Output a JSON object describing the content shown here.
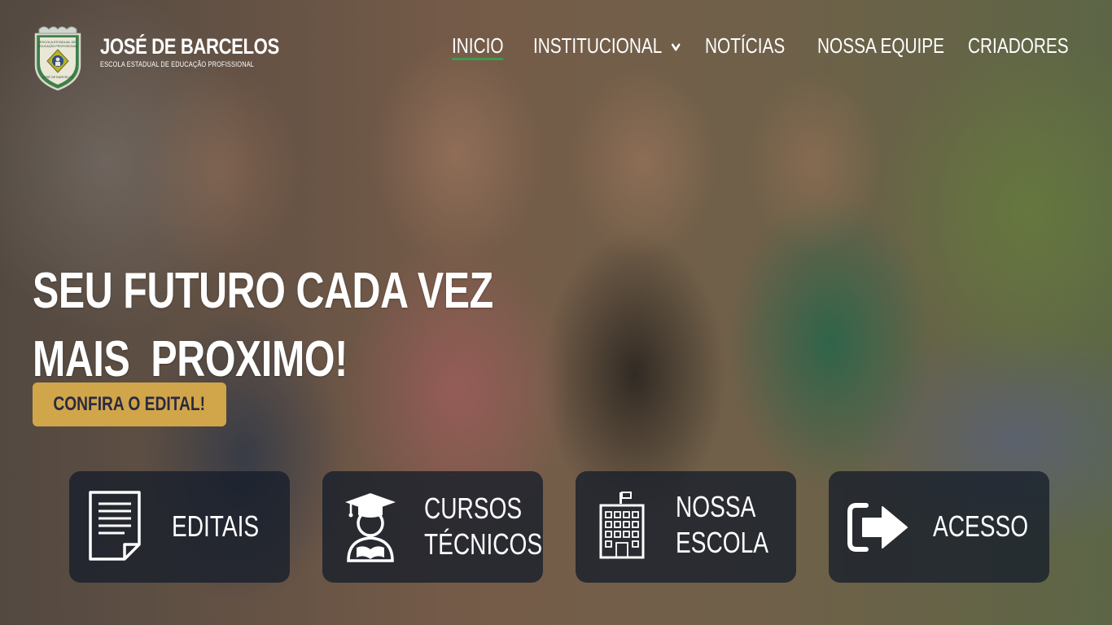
{
  "brand": {
    "logo_text": [
      "ESCOLA ESTADUAL DE",
      "EDUCAÇÃO PROFISSIONAL",
      "JOSÉ DE BARCELOS"
    ],
    "title": "JOSÉ DE BARCELOS",
    "subtitle": "ESCOLA ESTADUAL DE EDUCAÇÃO PROFISSIONAL"
  },
  "nav": {
    "items": [
      {
        "label": "INICIO",
        "active": true
      },
      {
        "label": "INSTITUCIONAL",
        "has_dropdown": true
      },
      {
        "label": "NOTÍCIAS"
      },
      {
        "label": "NOSSA EQUIPE"
      },
      {
        "label": "CRIADORES"
      }
    ]
  },
  "hero": {
    "headline": "SEU FUTURO CADA VEZ\nMAIS  PROXIMO!",
    "cta_label": "CONFIRA O EDITAL!"
  },
  "cards": [
    {
      "label": "EDITAIS",
      "icon": "document-icon"
    },
    {
      "label": "CURSOS\nTÉCNICOS",
      "icon": "graduate-icon"
    },
    {
      "label": "NOSSA\nESCOLA",
      "icon": "building-icon"
    },
    {
      "label": "ACESSO",
      "icon": "sign-in-icon"
    }
  ],
  "colors": {
    "accent_gold": "#d1a64a",
    "active_underline": "#3f9a4f",
    "card_bg": "rgba(22,30,42,0.78)",
    "cta_text": "#2b2a40"
  }
}
